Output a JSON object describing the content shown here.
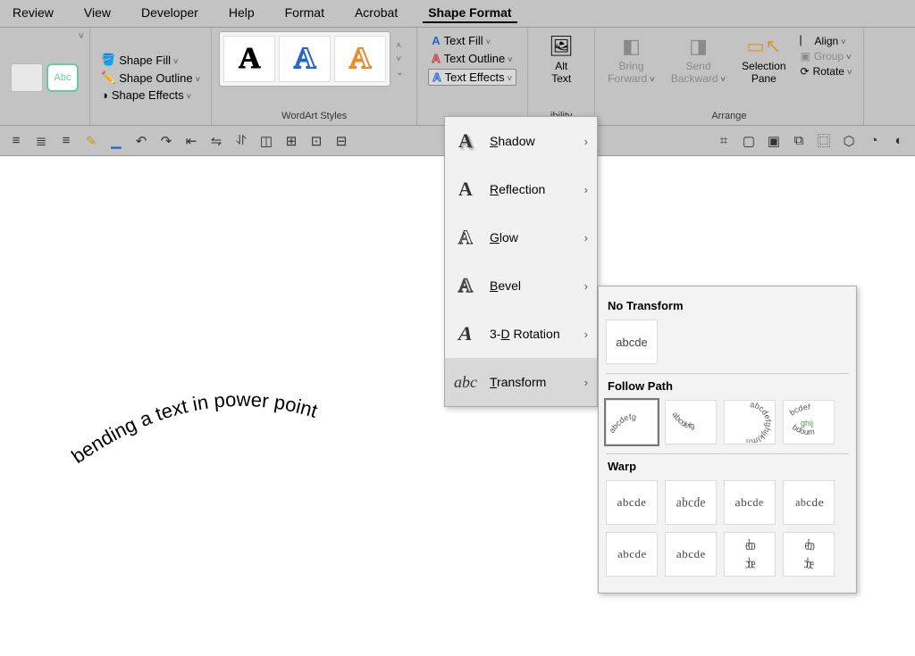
{
  "menubar": [
    "Review",
    "View",
    "Developer",
    "Help",
    "Format",
    "Acrobat",
    "Shape Format"
  ],
  "activeTab": "Shape Format",
  "ribbon": {
    "shapeGallery": {
      "abcLabel": "Abc"
    },
    "shapeTools": {
      "fill": "Shape Fill",
      "outline": "Shape Outline",
      "effects": "Shape Effects"
    },
    "wordArtGroup": "WordArt Styles",
    "wordArtGlyph": "A",
    "textTools": {
      "fill": "Text Fill",
      "outline": "Text Outline",
      "effects": "Text Effects"
    },
    "altText": {
      "label": "Alt\nText"
    },
    "accessibilityGroup": "ibility",
    "arrange": {
      "bringForward": "Bring\nForward",
      "sendBackward": "Send\nBackward",
      "selectionPane": "Selection\nPane",
      "align": "Align",
      "group": "Group",
      "rotate": "Rotate",
      "groupLabel": "Arrange"
    }
  },
  "dropdown": {
    "items": [
      {
        "label": "Shadow"
      },
      {
        "label": "Reflection"
      },
      {
        "label": "Glow"
      },
      {
        "label": "Bevel"
      },
      {
        "label": "3-D Rotation"
      },
      {
        "label": "Transform"
      }
    ]
  },
  "flyout": {
    "noTransformHeader": "No Transform",
    "noTransformSample": "abcde",
    "followPathHeader": "Follow Path",
    "warpHeader": "Warp",
    "warpSample": "abcde"
  },
  "canvasText": "bending a text in power point"
}
